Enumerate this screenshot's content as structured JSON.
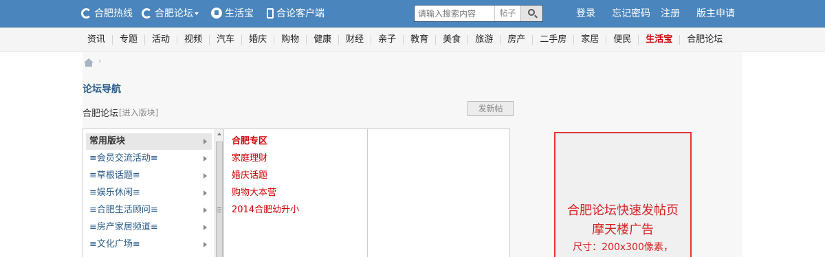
{
  "topbar": {
    "links": [
      "合肥热线",
      "合肥论坛",
      "生活宝",
      "合论客户端"
    ],
    "search_placeholder": "请输入搜索内容",
    "search_category": "帖子",
    "user_links": [
      "登录",
      "忘记密码",
      "注册",
      "版主申请"
    ]
  },
  "channels": [
    "资讯",
    "专题",
    "活动",
    "视频",
    "汽车",
    "婚庆",
    "购物",
    "健康",
    "财经",
    "亲子",
    "教育",
    "美食",
    "旅游",
    "房产",
    "二手房",
    "家居",
    "便民",
    "生活宝",
    "合肥论坛"
  ],
  "highlight_channel": "生活宝",
  "breadcrumb_sep": "›",
  "page": {
    "title": "论坛导航",
    "forum_name": "合肥论坛",
    "enter_link": "[进入版块]",
    "post_button": "发新帖"
  },
  "board_groups": [
    "常用版块",
    "≡会员交流活动≡",
    "≡草根话题≡",
    "≡娱乐休闲≡",
    "≡合肥生活顾问≡",
    "≡房产家居频道≡",
    "≡文化广场≡"
  ],
  "boards": [
    "合肥专区",
    "家庭理财",
    "婚庆话题",
    "购物大本营",
    "2014合肥幼升小"
  ],
  "ad": {
    "line1": "合肥论坛快速发帖页",
    "line2": "摩天楼广告",
    "line3": "尺寸：200x300像素，"
  },
  "colors": {
    "topbar": "#4a85bd",
    "link_red": "#cc0000",
    "link_blue": "#2a5d8a",
    "ad_border": "#e53333"
  }
}
